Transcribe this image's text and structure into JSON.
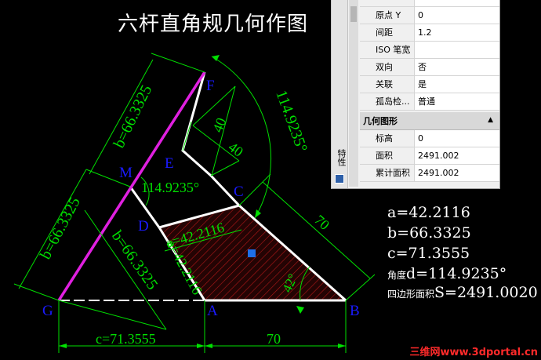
{
  "title": "六杆直角规几何作图",
  "points": [
    "F",
    "M",
    "E",
    "C",
    "D",
    "G",
    "A",
    "B"
  ],
  "dims": {
    "mf": "b=66.3325",
    "gm": "b=66.3325",
    "md": "b=66.3325",
    "arc_angle": "114.9235°",
    "angle_m": "114.9235°",
    "e40a": "40",
    "e40b": "40",
    "ad_a": "a=42.2116",
    "dc_a": "a=42.2116",
    "cb_70": "70",
    "angle_b": "42°",
    "ga_c": "c=71.3555",
    "ab_70": "70"
  },
  "results": {
    "a": "a=42.2116",
    "b": "b=66.3325",
    "c": "c=71.3555",
    "angle_prefix": "角度",
    "angle_val": "d=114.9235°",
    "area_prefix": "四边形面积",
    "area_val": "S=2491.0020"
  },
  "palette": {
    "rows_top": [
      {
        "k": "原点 Y",
        "v": "0"
      },
      {
        "k": "间距",
        "v": "1.2"
      },
      {
        "k": "ISO 笔宽",
        "v": ""
      },
      {
        "k": "双向",
        "v": "否"
      },
      {
        "k": "关联",
        "v": "是"
      },
      {
        "k": "孤岛检...",
        "v": "普通"
      }
    ],
    "section": "几何图形",
    "rows_geo": [
      {
        "k": "标高",
        "v": "0"
      },
      {
        "k": "面积",
        "v": "2491.002"
      },
      {
        "k": "累计面积",
        "v": "2491.002"
      }
    ],
    "side_label": "特性"
  },
  "watermark": "三维网www.3dportal.cn",
  "colors": {
    "line": "#ffffff",
    "dim": "#00ff00",
    "label": "#1a1aff",
    "magenta": "#e020e0",
    "hatch": "#a01010",
    "grip": "#1e6fe8"
  }
}
